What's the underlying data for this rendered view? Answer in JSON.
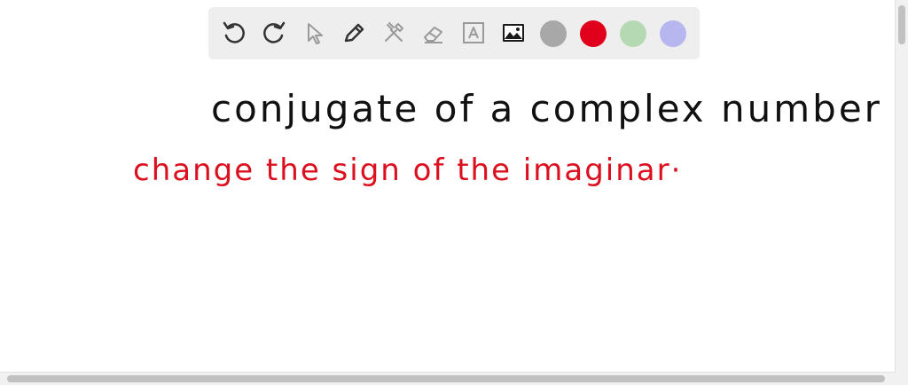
{
  "toolbar": {
    "tools": [
      {
        "icon": "undo-icon"
      },
      {
        "icon": "redo-icon"
      },
      {
        "icon": "select-pointer-icon"
      },
      {
        "icon": "pen-icon"
      },
      {
        "icon": "tools-icon"
      },
      {
        "icon": "eraser-icon"
      },
      {
        "icon": "text-box-icon"
      },
      {
        "icon": "image-icon"
      }
    ],
    "colors": [
      "#a8a8a8",
      "#e0001b",
      "#b5dab3",
      "#b8b6ee"
    ]
  },
  "board": {
    "line1": "conjugate of a complex number",
    "line2": "change the sign of the imaginar·",
    "line1_color": "#111111",
    "line2_color": "#dc0f1e"
  }
}
